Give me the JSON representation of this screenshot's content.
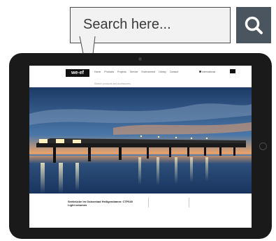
{
  "callout": {
    "search_placeholder": "Search here...",
    "search_icon": "search-icon"
  },
  "site": {
    "logo_text": "we-ef",
    "nav": [
      "Home",
      "Products",
      "Projects",
      "Service",
      "Environment",
      "Library",
      "Contact"
    ],
    "language": "International",
    "hint": "Search products and accessories"
  },
  "project": {
    "title_line1": "Seebrücke im Ostseebad Heiligendamm: CTF640",
    "title_line2": "Light columns"
  },
  "colors": {
    "search_button": "#4a5560",
    "tablet_frame": "#1a1a1a"
  }
}
